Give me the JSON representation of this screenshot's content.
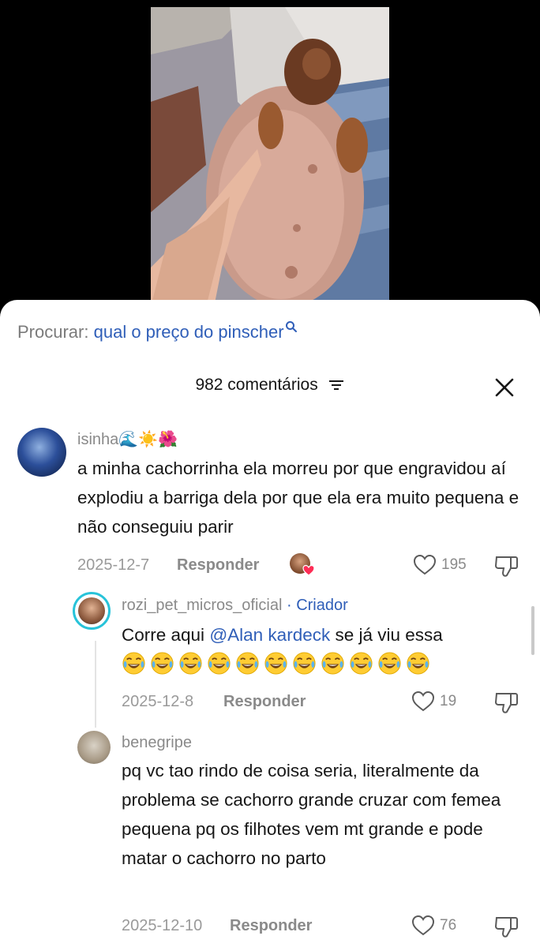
{
  "search": {
    "label": "Procurar:",
    "query": "qual o preço do pinscher"
  },
  "header": {
    "count": "982 comentários"
  },
  "comments": [
    {
      "username": "isinha🌊☀️🌺",
      "text": "a minha cachorrinha ela morreu por que engravidou aí explodiu a barriga dela por que ela era muito pequena e não conseguiu parir",
      "date": "2025-12-7",
      "reply": "Responder",
      "likes": "195"
    },
    {
      "username": "rozi_pet_micros_oficial",
      "creator_badge": "· Criador",
      "text_prefix": "Corre aqui ",
      "mention": "@Alan kardeck",
      "text_suffix": " se já viu essa",
      "emoji_count": 11,
      "date": "2025-12-8",
      "reply": "Responder",
      "likes": "19"
    },
    {
      "username": "benegripe",
      "text": "pq vc tao rindo de coisa seria, literalmente da problema se cachorro grande cruzar com femea pequena pq os filhotes vem mt grande e pode matar o cachorro no parto",
      "date": "2025-12-10",
      "reply": "Responder",
      "likes": "76"
    }
  ],
  "colors": {
    "link": "#2f5eb8",
    "muted": "#8a8a8a",
    "heart": "#fe2c55"
  },
  "icons": [
    "search-icon",
    "filter-icon",
    "close-icon",
    "heart-icon",
    "dislike-icon"
  ]
}
